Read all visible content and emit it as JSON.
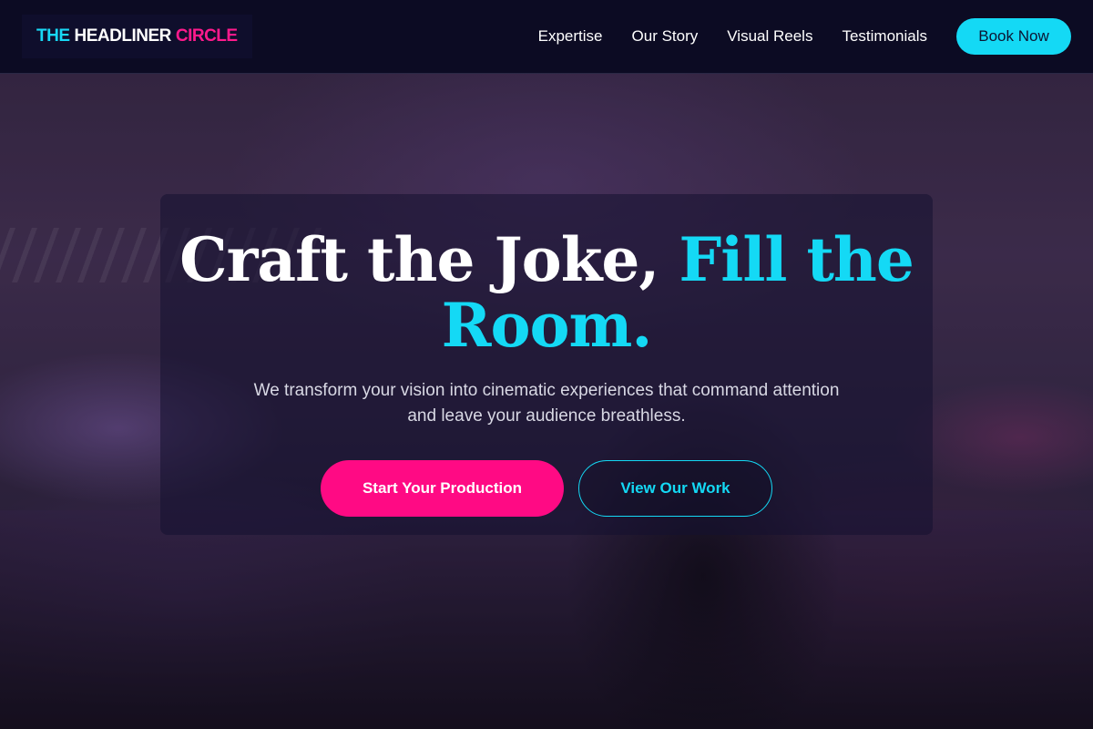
{
  "brand": {
    "part1": "THE",
    "part2": "HEADLINER",
    "part3": "CIRCLE"
  },
  "nav": {
    "items": [
      {
        "label": "Expertise"
      },
      {
        "label": "Our Story"
      },
      {
        "label": "Visual Reels"
      },
      {
        "label": "Testimonials"
      }
    ],
    "cta_label": "Book Now"
  },
  "hero": {
    "title_plain": "Craft the Joke,",
    "title_accent": "Fill the Room.",
    "subtitle": "We transform your vision into cinematic experiences that command attention and leave your audience breathless.",
    "primary_button": "Start Your Production",
    "secondary_button": "View Our Work"
  },
  "colors": {
    "accent_cyan": "#14d9f5",
    "accent_pink": "#ff0a84",
    "header_bg": "#0c0b23"
  }
}
